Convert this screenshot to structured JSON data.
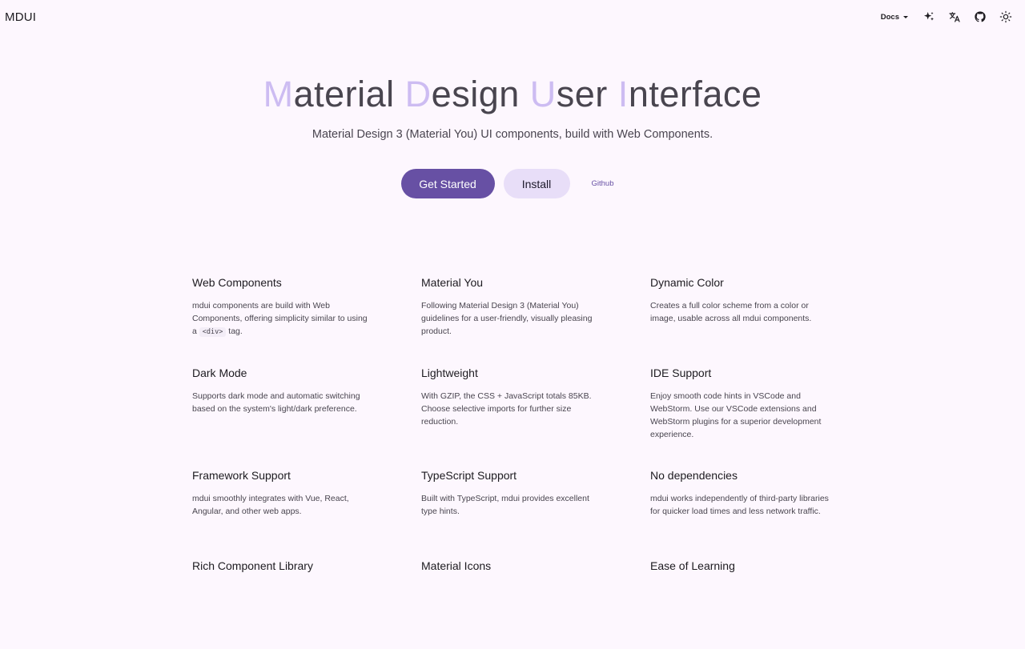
{
  "header": {
    "logo": "MDUI",
    "docs_label": "Docs",
    "icons": [
      "sparkle-icon",
      "translate-icon",
      "github-icon",
      "theme-icon"
    ]
  },
  "hero": {
    "title_parts": [
      {
        "cap": "M",
        "rest": "aterial"
      },
      {
        "cap": "D",
        "rest": "esign"
      },
      {
        "cap": "U",
        "rest": "ser"
      },
      {
        "cap": "I",
        "rest": "nterface"
      }
    ],
    "subtitle": "Material Design 3 (Material You) UI components, build with Web Components.",
    "get_started": "Get Started",
    "install": "Install",
    "github": "Github"
  },
  "features": [
    {
      "title": "Web Components",
      "desc_before": "mdui components are build with Web Components, offering simplicity similar to using a ",
      "code": "<div>",
      "desc_after": " tag."
    },
    {
      "title": "Material You",
      "desc_before": "Following Material Design 3 (Material You) guidelines for a user-friendly, visually pleasing product.",
      "code": "",
      "desc_after": ""
    },
    {
      "title": "Dynamic Color",
      "desc_before": "Creates a full color scheme from a color or image, usable across all mdui components.",
      "code": "",
      "desc_after": ""
    },
    {
      "title": "Dark Mode",
      "desc_before": "Supports dark mode and automatic switching based on the system's light/dark preference.",
      "code": "",
      "desc_after": ""
    },
    {
      "title": "Lightweight",
      "desc_before": "With GZIP, the CSS + JavaScript totals 85KB. Choose selective imports for further size reduction.",
      "code": "",
      "desc_after": ""
    },
    {
      "title": "IDE Support",
      "desc_before": "Enjoy smooth code hints in VSCode and WebStorm. Use our VSCode extensions and WebStorm plugins for a superior development experience.",
      "code": "",
      "desc_after": ""
    },
    {
      "title": "Framework Support",
      "desc_before": "mdui smoothly integrates with Vue, React, Angular, and other web apps.",
      "code": "",
      "desc_after": ""
    },
    {
      "title": "TypeScript Support",
      "desc_before": "Built with TypeScript, mdui provides excellent type hints.",
      "code": "",
      "desc_after": ""
    },
    {
      "title": "No dependencies",
      "desc_before": "mdui works independently of third-party libraries for quicker load times and less network traffic.",
      "code": "",
      "desc_after": ""
    },
    {
      "title": "Rich Component Library",
      "desc_before": "",
      "code": "",
      "desc_after": ""
    },
    {
      "title": "Material Icons",
      "desc_before": "",
      "code": "",
      "desc_after": ""
    },
    {
      "title": "Ease of Learning",
      "desc_before": "",
      "code": "",
      "desc_after": ""
    }
  ],
  "colors": {
    "background": "#fdf7fe",
    "primary": "#6750a4",
    "secondary_container": "#e8def8",
    "title_accent": "#cdbcf2"
  }
}
